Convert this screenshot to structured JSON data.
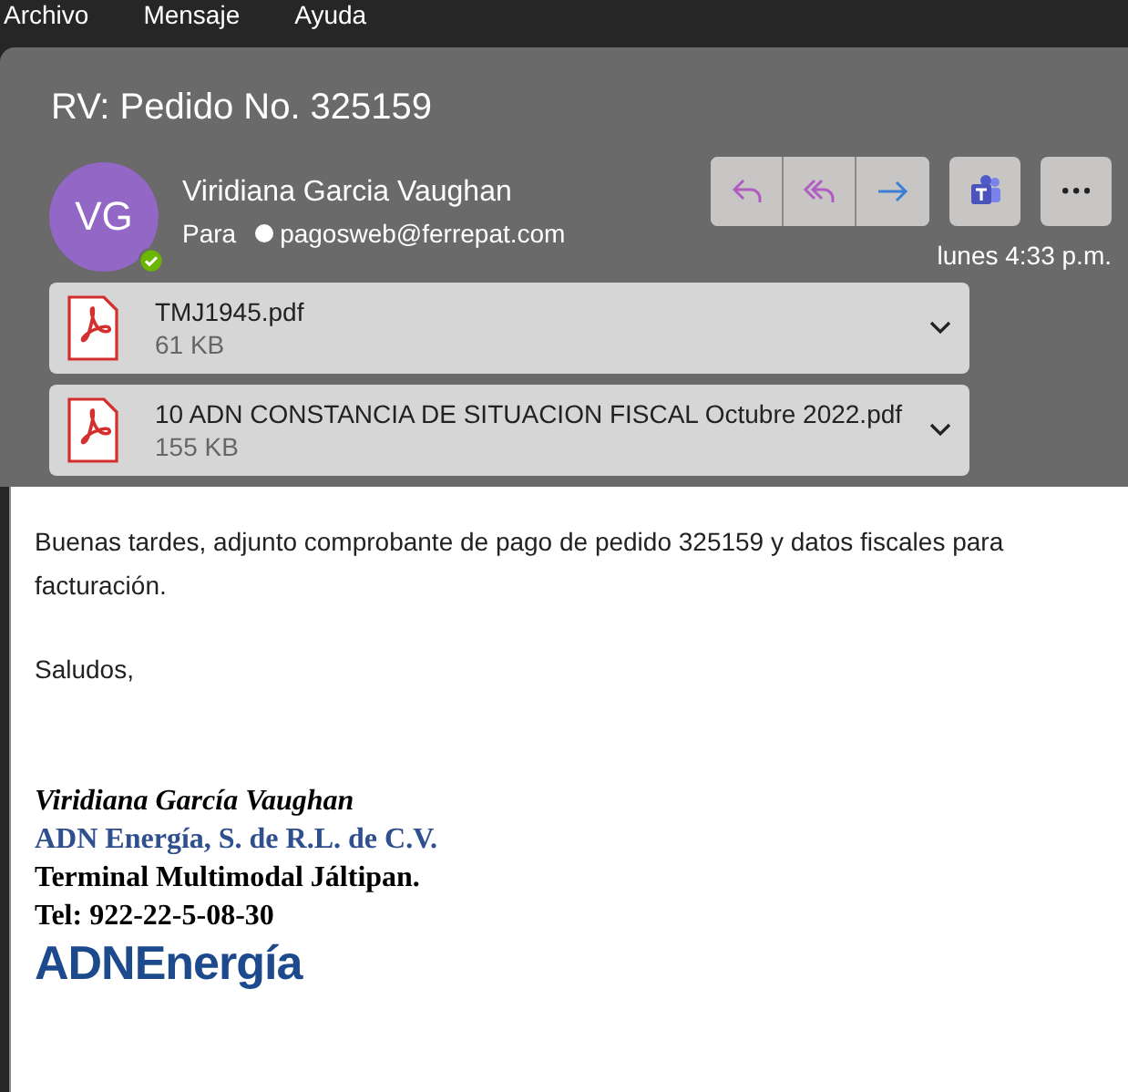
{
  "menu": [
    "Archivo",
    "Mensaje",
    "Ayuda"
  ],
  "subject": "RV: Pedido No. 325159",
  "sender": {
    "initials": "VG",
    "name": "Viridiana Garcia Vaughan",
    "online": true,
    "to_label": "Para",
    "to": "pagosweb@ferrepat.com",
    "date": "lunes 4:33 p.m."
  },
  "actions": [
    {
      "kind": "reply"
    },
    {
      "kind": "reply-all"
    },
    {
      "kind": "forward"
    }
  ],
  "attachments": [
    {
      "name": "TMJ1945.pdf",
      "size": "61 KB"
    },
    {
      "name": "10 ADN CONSTANCIA DE SITUACION FISCAL Octubre 2022.pdf",
      "size": "155 KB"
    }
  ],
  "body": [
    "Buenas tardes, adjunto comprobante de pago de pedido 325159 y datos fiscales para facturación.",
    "Saludos,"
  ],
  "signature": {
    "name": "Viridiana García Vaughan",
    "company": "ADN Energía, S. de R.L. de C.V.",
    "place": "Terminal Multimodal Jáltipan.",
    "phone": "Tel: 922-22-5-08-30",
    "logo": "ADNEnergía"
  }
}
